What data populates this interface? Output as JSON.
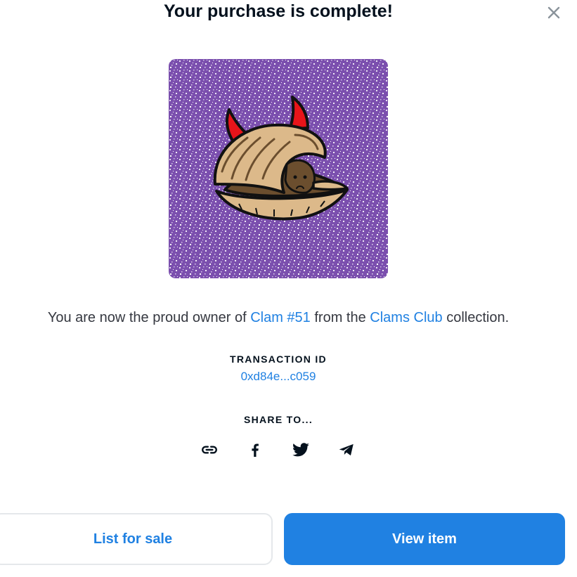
{
  "modal": {
    "title": "Your purchase is complete!",
    "close_icon": "close-icon"
  },
  "nft": {
    "image_alt": "Clam #51",
    "background_color": "#7b4fae"
  },
  "owner_message": {
    "prefix": "You are now the proud owner of ",
    "item_name": "Clam #51",
    "middle": " from the ",
    "collection_name": "Clams Club",
    "suffix": " collection."
  },
  "transaction": {
    "label": "TRANSACTION ID",
    "id": "0xd84e...c059"
  },
  "share": {
    "label": "SHARE TO...",
    "icons": [
      "link-icon",
      "facebook-icon",
      "twitter-icon",
      "telegram-icon"
    ]
  },
  "actions": {
    "list_for_sale": "List for sale",
    "view_item": "View item"
  },
  "colors": {
    "accent": "#2081e2",
    "text_primary": "#04111d",
    "text_secondary": "#353840"
  }
}
